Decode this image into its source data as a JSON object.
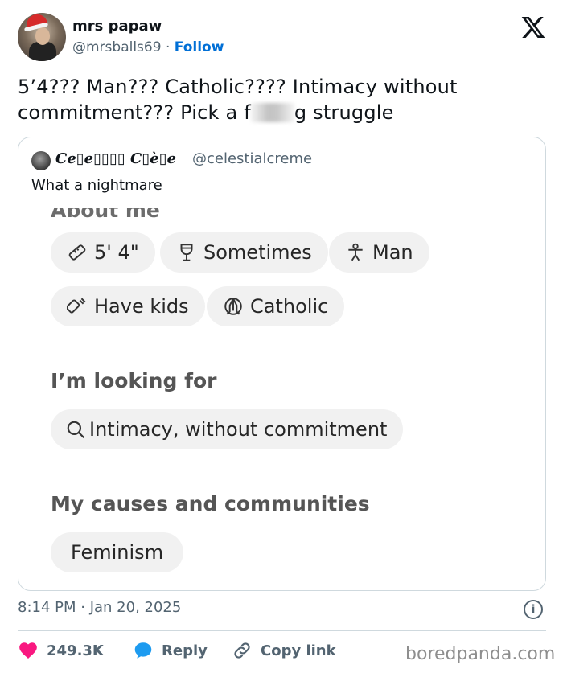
{
  "tweet": {
    "author_name": "mrs papaw",
    "author_handle": "@mrsballs69",
    "separator": "·",
    "follow_label": "Follow",
    "text_before_censor": "5’4??? Man??? Catholic???? Intimacy without commitment??? Pick a f",
    "text_after_censor": "g struggle",
    "timestamp": "8:14 PM · Jan 20, 2025"
  },
  "quote": {
    "author_name": "Ce▯e▯▯▯▯ C▯è▯e",
    "author_handle": "@celestialcreme",
    "text": "What a nightmare",
    "profile": {
      "cut_heading": "About me",
      "chips_row1": [
        {
          "icon": "ruler-icon",
          "label": "5' 4\""
        },
        {
          "icon": "wine-glass-icon",
          "label": "Sometimes"
        },
        {
          "icon": "person-icon",
          "label": "Man"
        }
      ],
      "chips_row2": [
        {
          "icon": "baby-bottle-icon",
          "label": "Have kids"
        },
        {
          "icon": "praying-hands-icon",
          "label": "Catholic"
        }
      ],
      "looking_for_title": "I’m looking for",
      "looking_for_chip": {
        "icon": "search-icon",
        "label": "Intimacy, without commitment"
      },
      "causes_title": "My causes and communities",
      "causes_chip": {
        "label": "Feminism"
      }
    }
  },
  "actions": {
    "likes": "249.3K",
    "reply_label": "Reply",
    "copy_link_label": "Copy link"
  },
  "watermark": "boredpanda.com",
  "colors": {
    "follow_blue": "#006fd6",
    "like_pink": "#f91880",
    "reply_blue": "#1d9bf0",
    "muted_gray": "#536471"
  }
}
